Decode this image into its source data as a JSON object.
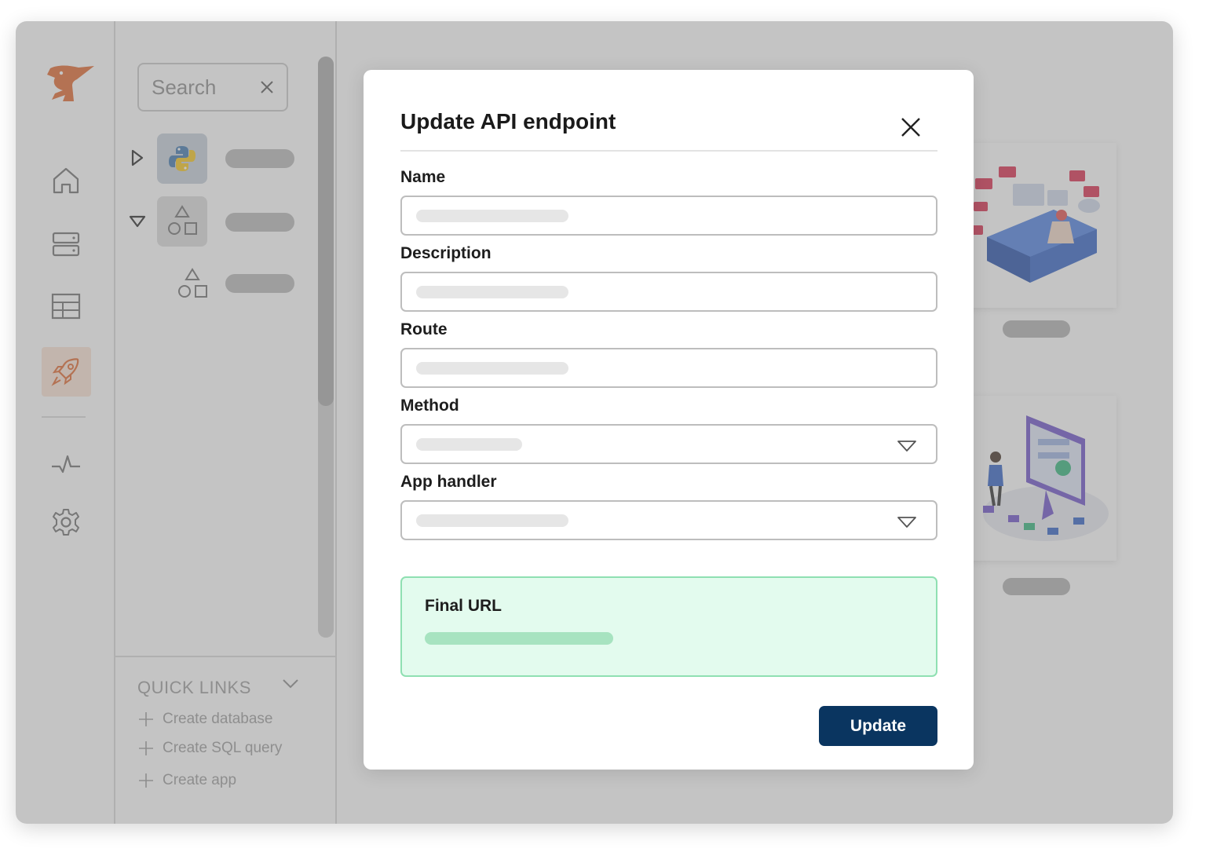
{
  "explorer": {
    "search": {
      "placeholder": "Search",
      "value": ""
    },
    "quick_links": {
      "title": "QUICK LINKS",
      "items": [
        {
          "label": "Create database"
        },
        {
          "label": "Create SQL query"
        },
        {
          "label": "Create app"
        }
      ]
    }
  },
  "modal": {
    "title": "Update API endpoint",
    "fields": {
      "name": {
        "label": "Name",
        "value": ""
      },
      "description": {
        "label": "Description",
        "value": ""
      },
      "route": {
        "label": "Route",
        "value": ""
      },
      "method": {
        "label": "Method",
        "value": ""
      },
      "app_handler": {
        "label": "App handler",
        "value": ""
      }
    },
    "final_url": {
      "label": "Final URL"
    },
    "update_label": "Update"
  },
  "colors": {
    "accent": "#0a3560",
    "brand": "#e0652a",
    "success_bg": "#e3fbee",
    "success_border": "#8fe0b2"
  },
  "icons": {
    "logo": "pelican-logo-icon",
    "nav": [
      "home-icon",
      "server-icon",
      "table-icon",
      "rocket-icon",
      "activity-icon",
      "gear-icon"
    ],
    "tree": [
      "python-icon",
      "shapes-icon",
      "shapes-icon"
    ]
  }
}
